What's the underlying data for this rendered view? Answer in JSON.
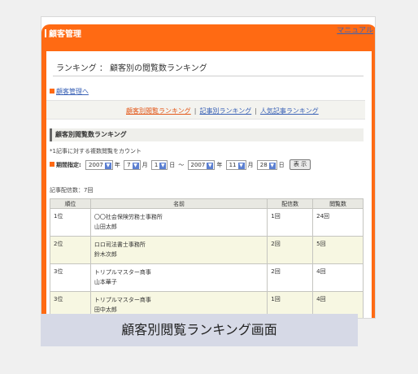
{
  "header": {
    "app_title": "顧客管理",
    "manual_link": "マニュアル"
  },
  "page": {
    "heading": "ランキング ： 顧客別の閲覧数ランキング",
    "back_link": "顧客管理へ"
  },
  "subnav": {
    "active": "顧客別閲覧ランキング",
    "link2": "記事別ランキング",
    "link3": "人気記事ランキング",
    "separator": "|"
  },
  "section": {
    "title": "顧客別閲覧数ランキング",
    "note": "*1記事に対する複数閲覧をカウント"
  },
  "period": {
    "label": "期間指定:",
    "from_year": "2007",
    "from_month": "7",
    "from_day": "1",
    "to_year": "2007",
    "to_month": "11",
    "to_day": "28",
    "unit_year": "年",
    "unit_month": "月",
    "unit_day": "日",
    "tilde": "～",
    "show_button": "表 示"
  },
  "summary": {
    "count_text": "記事配信数：7回"
  },
  "table": {
    "headers": [
      "順位",
      "名前",
      "配信数",
      "閲覧数"
    ],
    "rows": [
      {
        "rank": "1位",
        "org": "〇〇社会保険労務士事務所",
        "person": "山田太郎",
        "sent": "1回",
        "views": "24回"
      },
      {
        "rank": "2位",
        "org": "ロロ司法書士事務所",
        "person": "鈴木次郎",
        "sent": "2回",
        "views": "5回"
      },
      {
        "rank": "3位",
        "org": "トリプルマスター商事",
        "person": "山本華子",
        "sent": "2回",
        "views": "4回"
      },
      {
        "rank": "3位",
        "org": "トリプルマスター商事",
        "person": "田中太郎",
        "sent": "1回",
        "views": "4回"
      }
    ]
  },
  "caption": "顧客別閲覧ランキング画面",
  "colors": {
    "accent": "#ff6a13",
    "link": "#3a62b6",
    "row_alt": "#f7f7e2",
    "caption_bg": "#d6d9e6"
  }
}
